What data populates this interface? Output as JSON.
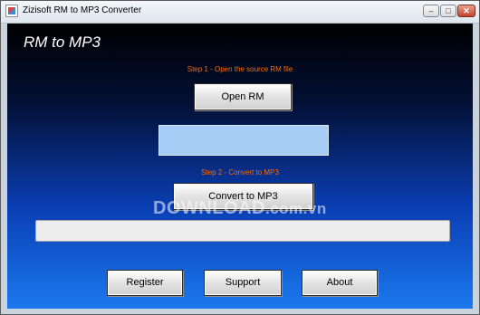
{
  "window": {
    "title": "Zizisoft RM to MP3 Converter",
    "controls": {
      "minimize_icon": "minimize-icon",
      "maximize_icon": "maximize-icon",
      "close_icon": "close-icon",
      "minimize_glyph": "–",
      "maximize_glyph": "□",
      "close_glyph": "✕"
    }
  },
  "app": {
    "title": "RM to MP3"
  },
  "step1": {
    "label": "Step 1 - Open the source RM file",
    "button": "Open RM",
    "file_path": ""
  },
  "step2": {
    "label": "Step 2 - Convert to MP3",
    "button": "Convert to MP3",
    "progress": 0
  },
  "footer": {
    "register": "Register",
    "support": "Support",
    "about": "About"
  },
  "watermark": {
    "brand": "DOWNLOAD",
    "domain": ".com.vn"
  },
  "colors": {
    "step_label": "#ff6a00",
    "gradient_top": "#000000",
    "gradient_bottom": "#1c79ee",
    "path_box": "#a6cdf5"
  }
}
